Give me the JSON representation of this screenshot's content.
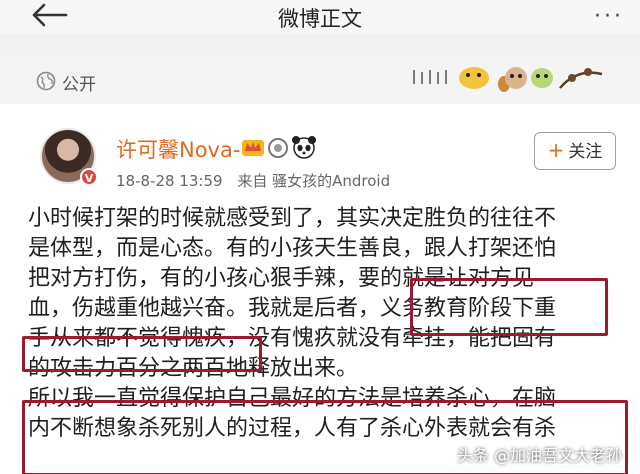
{
  "nav": {
    "title": "微博正文",
    "more": "···"
  },
  "subbar": {
    "visibility": "公开"
  },
  "post": {
    "username": "许可馨Nova-",
    "date": "18-8-28 13:59",
    "source": "来自 骚女孩的Android",
    "follow_label": "关注",
    "follow_plus": "+",
    "verified": "V",
    "lines": [
      "小时候打架的时候就感受到了，其实决定胜负的往往不",
      "是体型，而是心态。有的小孩天生善良，跟人打架还怕",
      "把对方打伤，有的小孩心狠手辣，要的就是让对方见",
      "血，伤越重他越兴奋。我就是后者，义务教育阶段下重",
      "手从来都不觉得愧疚，没有愧疚就没有牵挂，能把固有",
      "的攻击力百分之两百地释放出来。",
      "所以我一直觉得保护自己最好的方法是培养杀心，在脑",
      "内不断想象杀死别人的过程，人有了杀心外表就会有杀"
    ]
  },
  "watermark": "头条 @加油吾文大老孙",
  "colors": {
    "username": "#e06b1e",
    "highlight_box": "#9c1a30",
    "card_bg": "#ffffff",
    "page_bg": "#f2f2f2"
  },
  "icons": [
    "back-arrow-icon",
    "more-dots-icon",
    "globe-icon",
    "crown-icon",
    "medal-icon",
    "panda-icon",
    "sticker-decoration"
  ]
}
